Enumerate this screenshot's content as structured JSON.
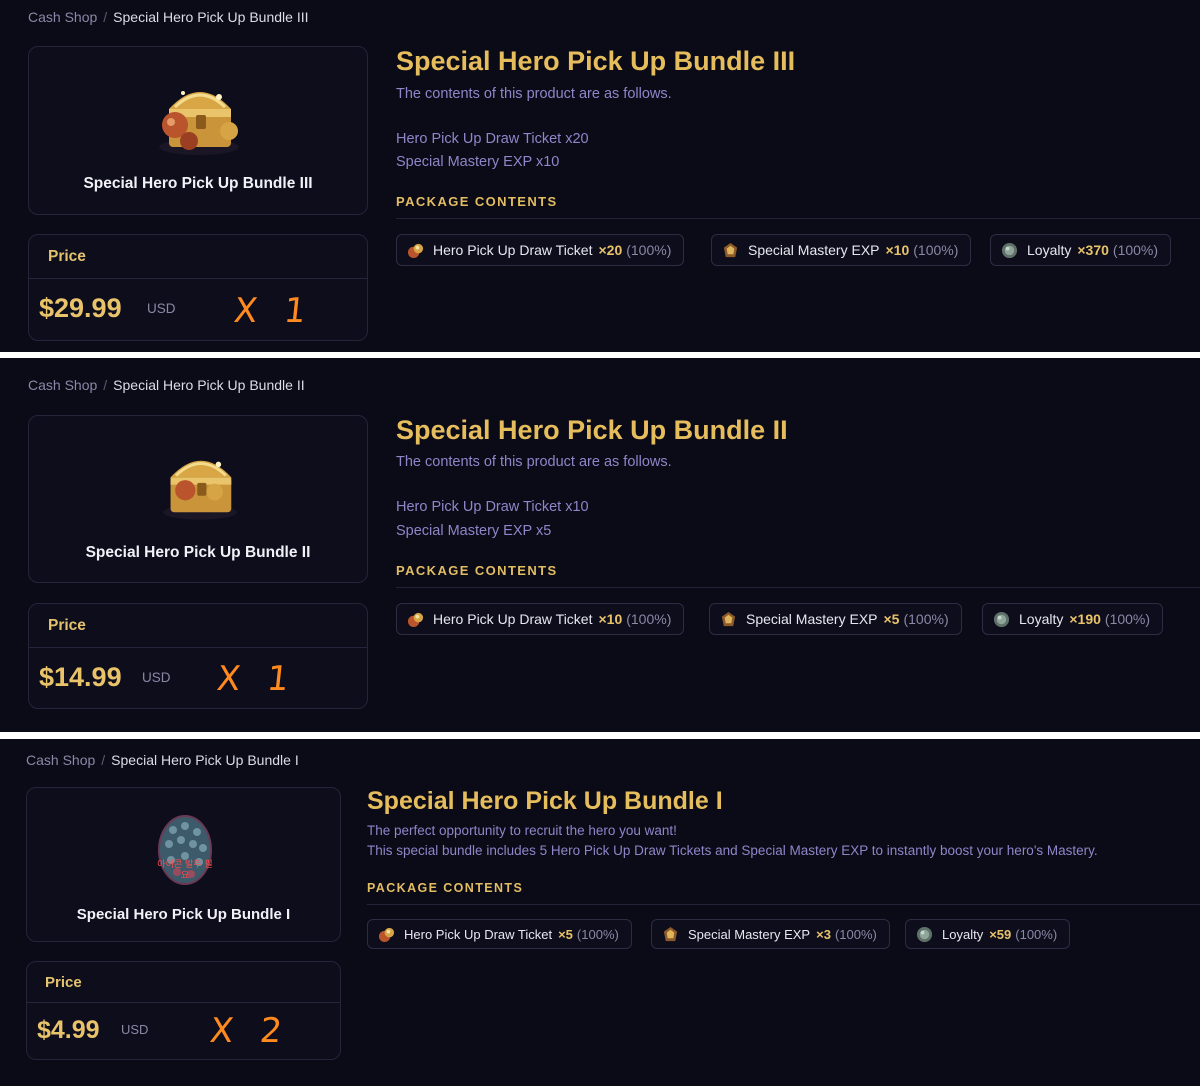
{
  "panels": [
    {
      "breadcrumb": {
        "root": "Cash Shop",
        "separator": "/",
        "current": "Special Hero Pick Up Bundle III"
      },
      "card": {
        "name": "Special Hero Pick Up Bundle III",
        "image": "treasure-chest"
      },
      "price": {
        "label": "Price",
        "amount": "$29.99",
        "currency": "USD",
        "note": "X 1"
      },
      "title": "Special Hero Pick Up Bundle III",
      "description": [
        "The contents of this product are as follows."
      ],
      "details": [
        "Hero Pick Up Draw Ticket x20",
        "Special Mastery EXP x10"
      ],
      "package_heading": "PACKAGE CONTENTS",
      "items": [
        {
          "icon": "draw-ticket-icon",
          "name": "Hero Pick Up Draw Ticket",
          "qty": "×20",
          "pct": "(100%)"
        },
        {
          "icon": "mastery-exp-icon",
          "name": "Special Mastery EXP",
          "qty": "×10",
          "pct": "(100%)"
        },
        {
          "icon": "loyalty-icon",
          "name": "Loyalty",
          "qty": "×370",
          "pct": "(100%)"
        }
      ]
    },
    {
      "breadcrumb": {
        "root": "Cash Shop",
        "separator": "/",
        "current": "Special Hero Pick Up Bundle II"
      },
      "card": {
        "name": "Special Hero Pick Up Bundle II",
        "image": "treasure-chest"
      },
      "price": {
        "label": "Price",
        "amount": "$14.99",
        "currency": "USD",
        "note": "X 1"
      },
      "title": "Special Hero Pick Up Bundle II",
      "description": [
        "The contents of this product are as follows."
      ],
      "details": [
        "Hero Pick Up Draw Ticket x10",
        "Special Mastery EXP x5"
      ],
      "package_heading": "PACKAGE CONTENTS",
      "items": [
        {
          "icon": "draw-ticket-icon",
          "name": "Hero Pick Up Draw Ticket",
          "qty": "×10",
          "pct": "(100%)"
        },
        {
          "icon": "mastery-exp-icon",
          "name": "Special Mastery EXP",
          "qty": "×5",
          "pct": "(100%)"
        },
        {
          "icon": "loyalty-icon",
          "name": "Loyalty",
          "qty": "×190",
          "pct": "(100%)"
        }
      ]
    },
    {
      "breadcrumb": {
        "root": "Cash Shop",
        "separator": "/",
        "current": "Special Hero Pick Up Bundle I"
      },
      "card": {
        "name": "Special Hero Pick Up Bundle I",
        "image": "egg",
        "image_caption": "아이콘 발주 필요"
      },
      "price": {
        "label": "Price",
        "amount": "$4.99",
        "currency": "USD",
        "note": "X 2"
      },
      "title": "Special Hero Pick Up Bundle I",
      "description": [
        "The perfect opportunity to recruit the hero you want!",
        "This special bundle includes 5 Hero Pick Up Draw Tickets and Special Mastery EXP to instantly boost your hero's Mastery."
      ],
      "details": [],
      "package_heading": "PACKAGE CONTENTS",
      "items": [
        {
          "icon": "draw-ticket-icon",
          "name": "Hero Pick Up Draw Ticket",
          "qty": "×5",
          "pct": "(100%)"
        },
        {
          "icon": "mastery-exp-icon",
          "name": "Special Mastery EXP",
          "qty": "×3",
          "pct": "(100%)"
        },
        {
          "icon": "loyalty-icon",
          "name": "Loyalty",
          "qty": "×59",
          "pct": "(100%)"
        }
      ]
    }
  ]
}
